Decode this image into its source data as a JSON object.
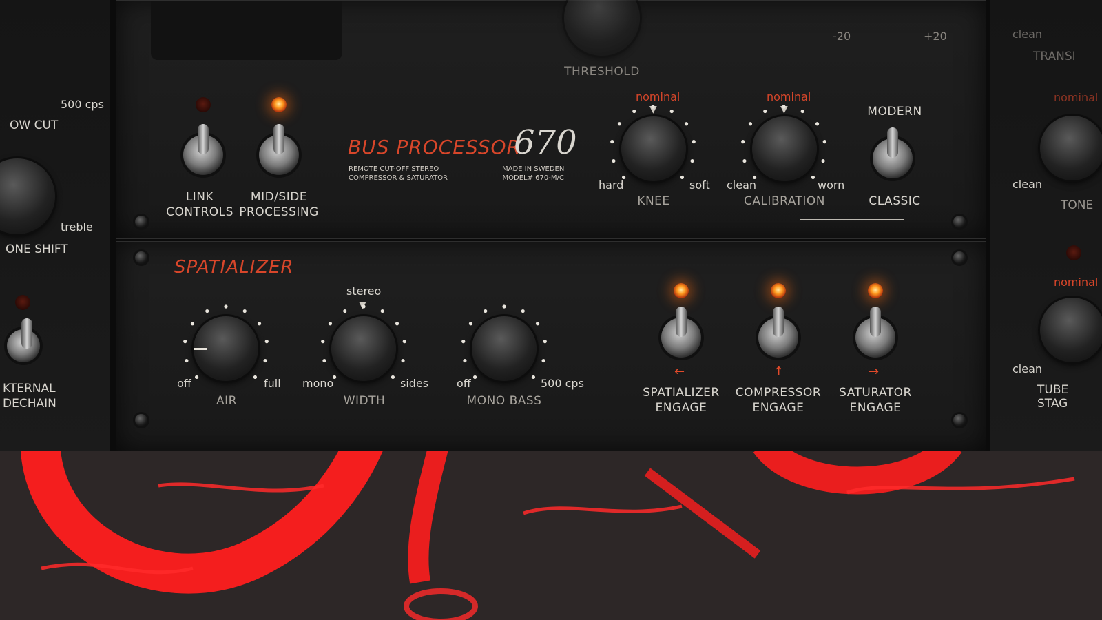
{
  "colors": {
    "accent_red": "#d8462a",
    "lamp_on": "#ffb030",
    "panel": "#1c1c1c",
    "backdrop_red": "#ff1e1e"
  },
  "left_rack": {
    "low_cut_value": "500 cps",
    "low_cut_label": "OW CUT",
    "tone_shift_value": "treble",
    "tone_shift_label": "ONE SHIFT",
    "sidechain_label": "KTERNAL\nDECHAIN"
  },
  "right_rack": {
    "clean_1": "clean",
    "transient_label": "TRANSI",
    "nominal": "nominal",
    "clean_2": "clean",
    "tone_label": "TONE",
    "clean_3": "clean",
    "tube_stage_label": "TUBE STAG"
  },
  "top_panel": {
    "threshold_label": "THRESHOLD",
    "meter_min": "-20",
    "meter_max": "+20",
    "link_controls": "LINK\nCONTROLS",
    "mid_side": "MID/SIDE\nPROCESSING",
    "title": "BUS PROCESSOR",
    "model_number": "670",
    "subtitle": "REMOTE CUT-OFF STEREO\nCOMPRESSOR & SATURATOR",
    "made_in": "MADE IN SWEDEN\nMODEL# 670-M/C",
    "knee": {
      "nominal": "nominal",
      "min": "hard",
      "max": "soft",
      "label": "KNEE"
    },
    "calibration": {
      "nominal": "nominal",
      "min": "clean",
      "max": "worn",
      "label": "CALIBRATION"
    },
    "mode_top": "MODERN",
    "mode_bottom": "CLASSIC"
  },
  "spatializer": {
    "title": "SPATIALIZER",
    "air": {
      "min": "off",
      "max": "full",
      "label": "AIR"
    },
    "width": {
      "top": "stereo",
      "min": "mono",
      "max": "sides",
      "label": "WIDTH"
    },
    "mono_bass": {
      "min": "off",
      "max": "500 cps",
      "label": "MONO BASS"
    },
    "engage": [
      {
        "label": "SPATIALIZER\nENGAGE",
        "arrow": "←"
      },
      {
        "label": "COMPRESSOR\nENGAGE",
        "arrow": "↑"
      },
      {
        "label": "SATURATOR\nENGAGE",
        "arrow": "→"
      }
    ]
  }
}
